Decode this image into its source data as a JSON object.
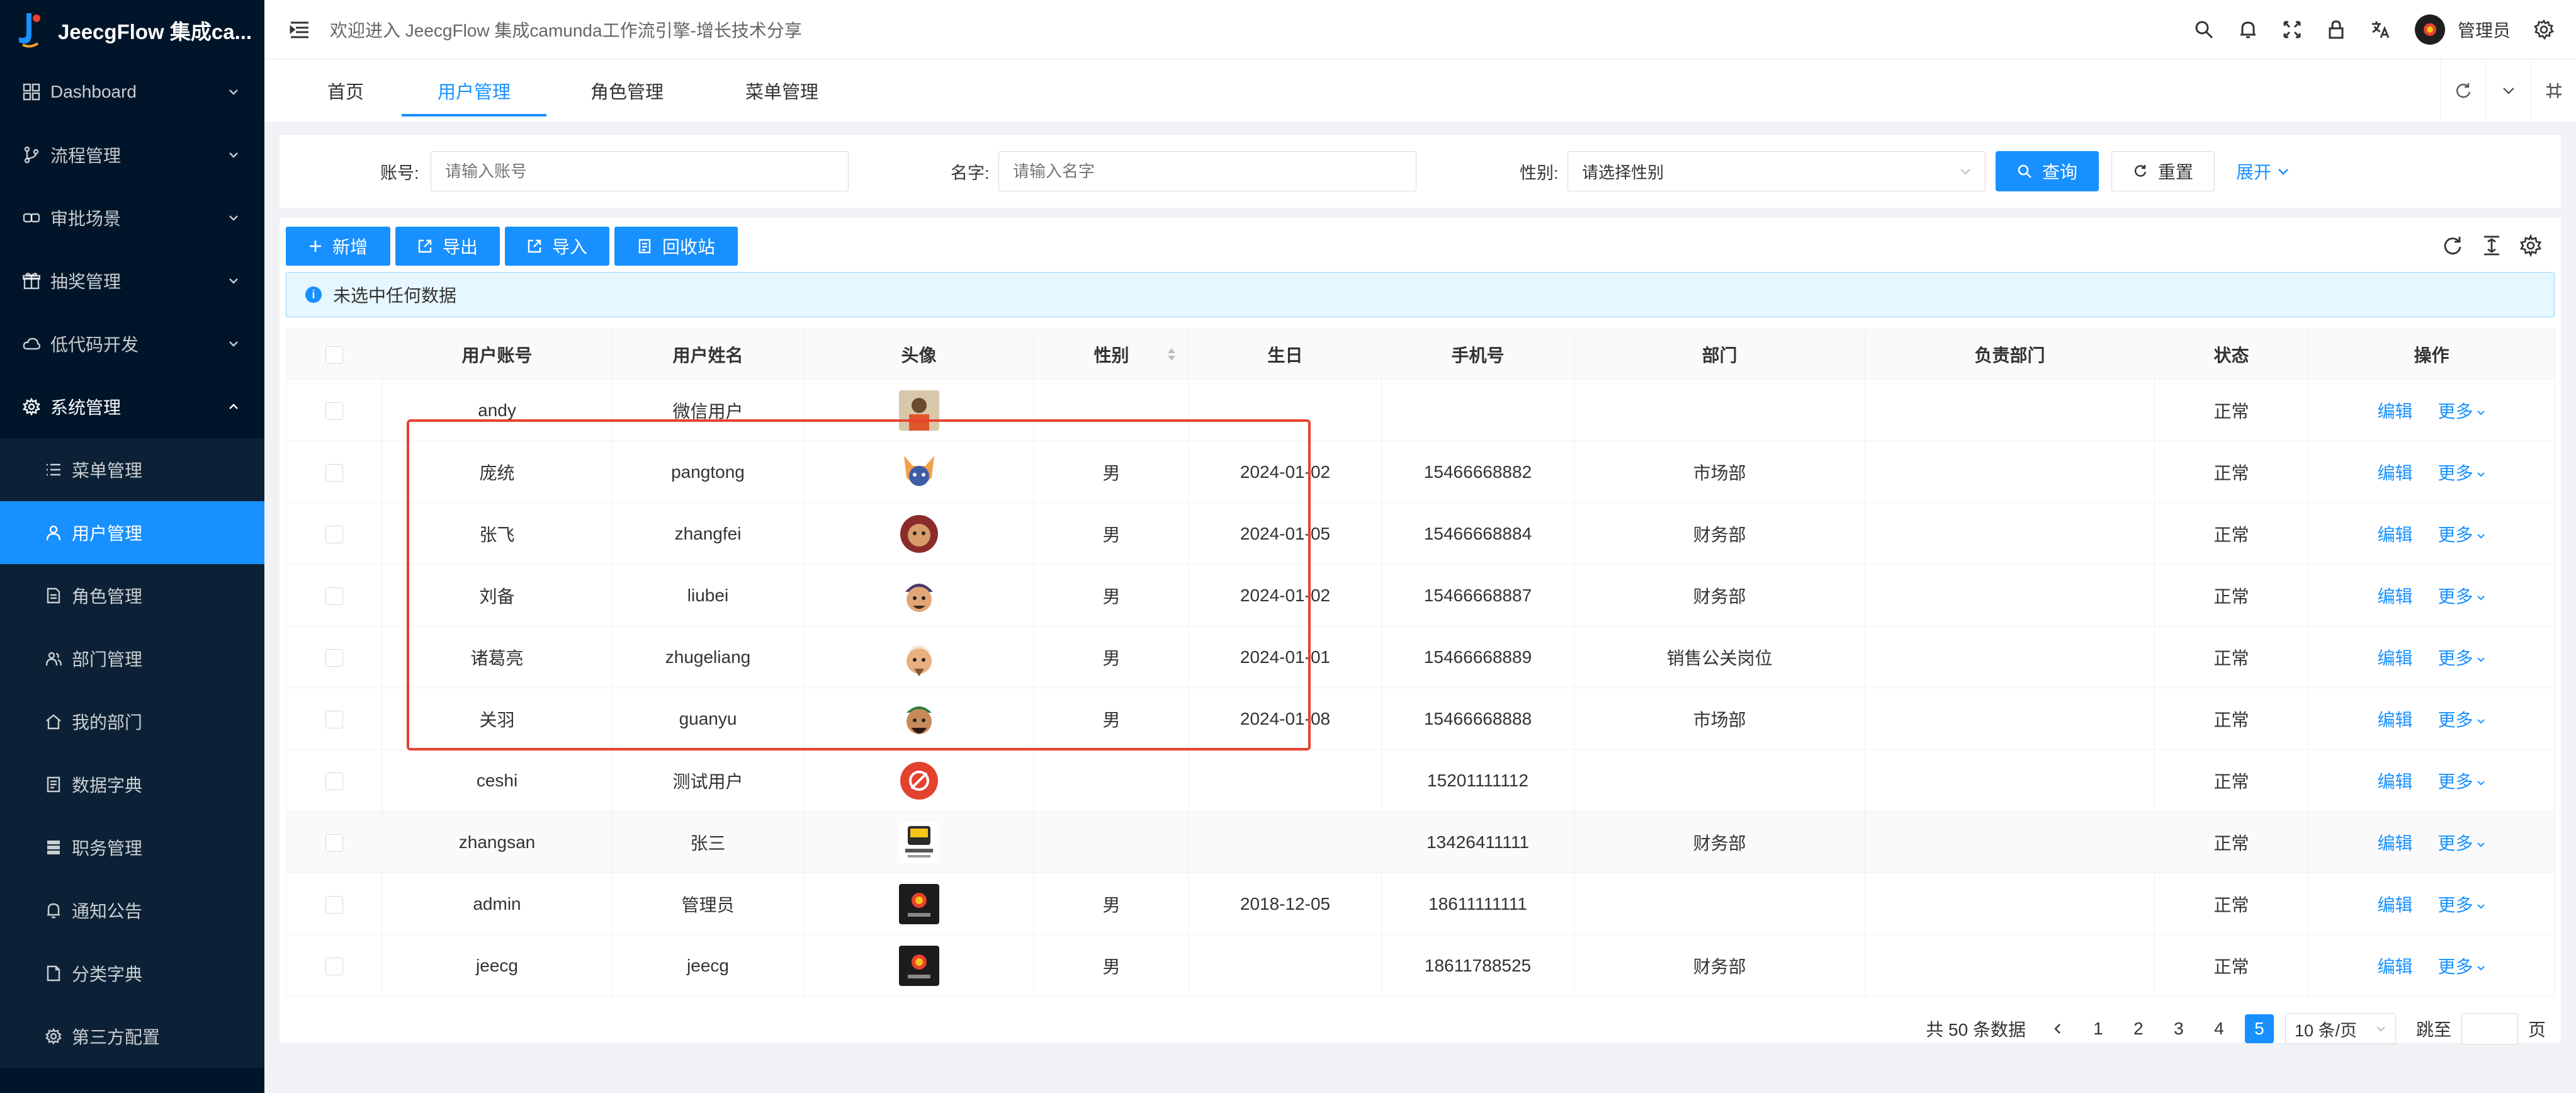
{
  "app": {
    "title": "JeecgFlow 集成ca...",
    "welcome": "欢迎进入 JeecgFlow 集成camunda工作流引擎-增长技术分享",
    "user": "管理员"
  },
  "sidebar": {
    "menus": [
      {
        "label": "Dashboard",
        "icon": "dashboard-icon"
      },
      {
        "label": "流程管理",
        "icon": "branch-icon"
      },
      {
        "label": "审批场景",
        "icon": "link-icon"
      },
      {
        "label": "抽奖管理",
        "icon": "gift-icon"
      },
      {
        "label": "低代码开发",
        "icon": "cloud-icon"
      },
      {
        "label": "系统管理",
        "icon": "gear-icon"
      }
    ],
    "sub_items": [
      {
        "label": "菜单管理",
        "icon": "list-icon"
      },
      {
        "label": "用户管理",
        "icon": "user-icon"
      },
      {
        "label": "角色管理",
        "icon": "file-icon"
      },
      {
        "label": "部门管理",
        "icon": "team-icon"
      },
      {
        "label": "我的部门",
        "icon": "home-icon"
      },
      {
        "label": "数据字典",
        "icon": "book-icon"
      },
      {
        "label": "职务管理",
        "icon": "table-icon"
      },
      {
        "label": "通知公告",
        "icon": "bell-icon"
      },
      {
        "label": "分类字典",
        "icon": "doc-icon"
      },
      {
        "label": "第三方配置",
        "icon": "setting-icon"
      }
    ]
  },
  "tabs": [
    "首页",
    "用户管理",
    "角色管理",
    "菜单管理"
  ],
  "search": {
    "account_label": "账号:",
    "account_placeholder": "请输入账号",
    "name_label": "名字:",
    "name_placeholder": "请输入名字",
    "gender_label": "性别:",
    "gender_value": "请选择性别",
    "query": "查询",
    "reset": "重置",
    "expand": "展开"
  },
  "toolbar": {
    "add": "新增",
    "export": "导出",
    "import": "导入",
    "recycle": "回收站"
  },
  "alert": "未选中任何数据",
  "table": {
    "columns": [
      "用户账号",
      "用户姓名",
      "头像",
      "性别",
      "生日",
      "手机号",
      "部门",
      "负责部门",
      "状态",
      "操作"
    ],
    "edit_label": "编辑",
    "more_label": "更多",
    "rows": [
      {
        "account": "andy",
        "name": "微信用户",
        "avatar": "photo",
        "gender": "",
        "birthday": "",
        "phone": "",
        "dept": "",
        "owner_dept": "",
        "status": "正常"
      },
      {
        "account": "庞统",
        "name": "pangtong",
        "avatar": "fox",
        "gender": "男",
        "birthday": "2024-01-02",
        "phone": "15466668882",
        "dept": "市场部",
        "owner_dept": "",
        "status": "正常"
      },
      {
        "account": "张飞",
        "name": "zhangfei",
        "avatar": "lion",
        "gender": "男",
        "birthday": "2024-01-05",
        "phone": "15466668884",
        "dept": "财务部",
        "owner_dept": "",
        "status": "正常"
      },
      {
        "account": "刘备",
        "name": "liubei",
        "avatar": "warrior",
        "gender": "男",
        "birthday": "2024-01-02",
        "phone": "15466668887",
        "dept": "财务部",
        "owner_dept": "",
        "status": "正常"
      },
      {
        "account": "诸葛亮",
        "name": "zhugeliang",
        "avatar": "sage",
        "gender": "男",
        "birthday": "2024-01-01",
        "phone": "15466668889",
        "dept": "销售公关岗位",
        "owner_dept": "",
        "status": "正常"
      },
      {
        "account": "关羽",
        "name": "guanyu",
        "avatar": "general",
        "gender": "男",
        "birthday": "2024-01-08",
        "phone": "15466668888",
        "dept": "市场部",
        "owner_dept": "",
        "status": "正常"
      },
      {
        "account": "ceshi",
        "name": "测试用户",
        "avatar": "red-badge",
        "gender": "",
        "birthday": "",
        "phone": "15201111112",
        "dept": "",
        "owner_dept": "",
        "status": "正常"
      },
      {
        "account": "zhangsan",
        "name": "张三",
        "avatar": "bus",
        "gender": "",
        "birthday": "",
        "phone": "13426411111",
        "dept": "财务部",
        "owner_dept": "",
        "status": "正常"
      },
      {
        "account": "admin",
        "name": "管理员",
        "avatar": "logo",
        "gender": "男",
        "birthday": "2018-12-05",
        "phone": "18611111111",
        "dept": "",
        "owner_dept": "",
        "status": "正常"
      },
      {
        "account": "jeecg",
        "name": "jeecg",
        "avatar": "logo",
        "gender": "男",
        "birthday": "",
        "phone": "18611788525",
        "dept": "财务部",
        "owner_dept": "",
        "status": "正常"
      }
    ]
  },
  "pagination": {
    "total_text": "共 50 条数据",
    "pages": [
      "1",
      "2",
      "3",
      "4",
      "5"
    ],
    "current": "5",
    "page_size": "10 条/页",
    "jump_label": "跳至",
    "page_suffix": "页"
  },
  "colors": {
    "primary": "#1890ff",
    "sidebar_bg": "#001529",
    "highlight": "#e8412f"
  }
}
